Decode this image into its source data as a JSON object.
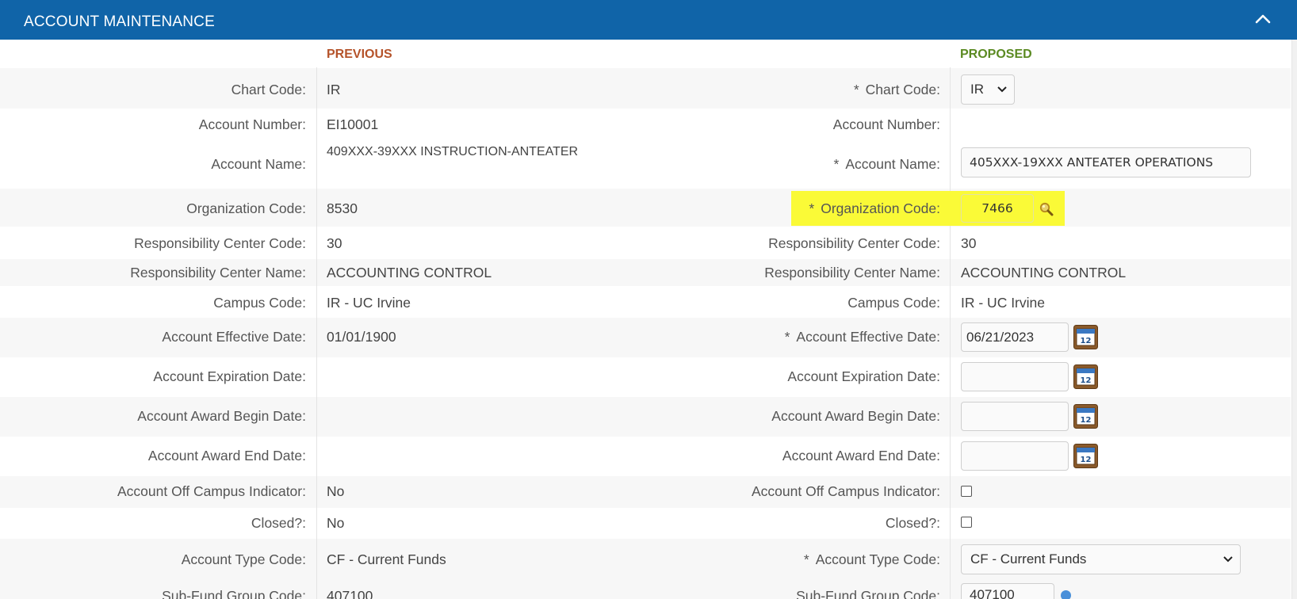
{
  "header": {
    "title": "ACCOUNT MAINTENANCE"
  },
  "columns": {
    "previous": "PREVIOUS",
    "proposed": "PROPOSED"
  },
  "required_mark": "*",
  "fields": {
    "chart_code": {
      "label": "Chart Code:",
      "previous": "IR",
      "proposed": "IR"
    },
    "account_number": {
      "label": "Account Number:",
      "previous": "EI10001",
      "proposed": ""
    },
    "account_name": {
      "label": "Account Name:",
      "previous": "409XXX-39XXX INSTRUCTION-ANTEATER",
      "proposed": "405XXX-19XXX ANTEATER OPERATIONS"
    },
    "organization_code": {
      "label": "Organization Code:",
      "previous": "8530",
      "proposed": "7466"
    },
    "resp_center_code": {
      "label": "Responsibility Center Code:",
      "previous": "30",
      "proposed": "30"
    },
    "resp_center_name": {
      "label": "Responsibility Center Name:",
      "previous": "ACCOUNTING CONTROL",
      "proposed": "ACCOUNTING CONTROL"
    },
    "campus_code": {
      "label": "Campus Code:",
      "previous": "IR - UC Irvine",
      "proposed": "IR - UC Irvine"
    },
    "effective_date": {
      "label": "Account Effective Date:",
      "previous": "01/01/1900",
      "proposed": "06/21/2023"
    },
    "expiration_date": {
      "label": "Account Expiration Date:",
      "previous": "",
      "proposed": ""
    },
    "award_begin_date": {
      "label": "Account Award Begin Date:",
      "previous": "",
      "proposed": ""
    },
    "award_end_date": {
      "label": "Account Award End Date:",
      "previous": "",
      "proposed": ""
    },
    "off_campus": {
      "label": "Account Off Campus Indicator:",
      "previous": "No",
      "proposed_checked": false
    },
    "closed": {
      "label": "Closed?:",
      "previous": "No",
      "proposed_checked": false
    },
    "account_type": {
      "label": "Account Type Code:",
      "previous": "CF - Current Funds",
      "proposed": "CF - Current Funds"
    },
    "sub_fund_group": {
      "label": "Sub-Fund Group Code:",
      "previous": "407100",
      "proposed": "407100"
    }
  },
  "colors": {
    "header": "#1064a8",
    "previous": "#b5532a",
    "proposed": "#5b8a22",
    "highlight": "#fafa37"
  },
  "icons": {
    "collapse": "chevron-up-icon",
    "calendar": "calendar-icon",
    "lookup": "magnifier-icon"
  }
}
